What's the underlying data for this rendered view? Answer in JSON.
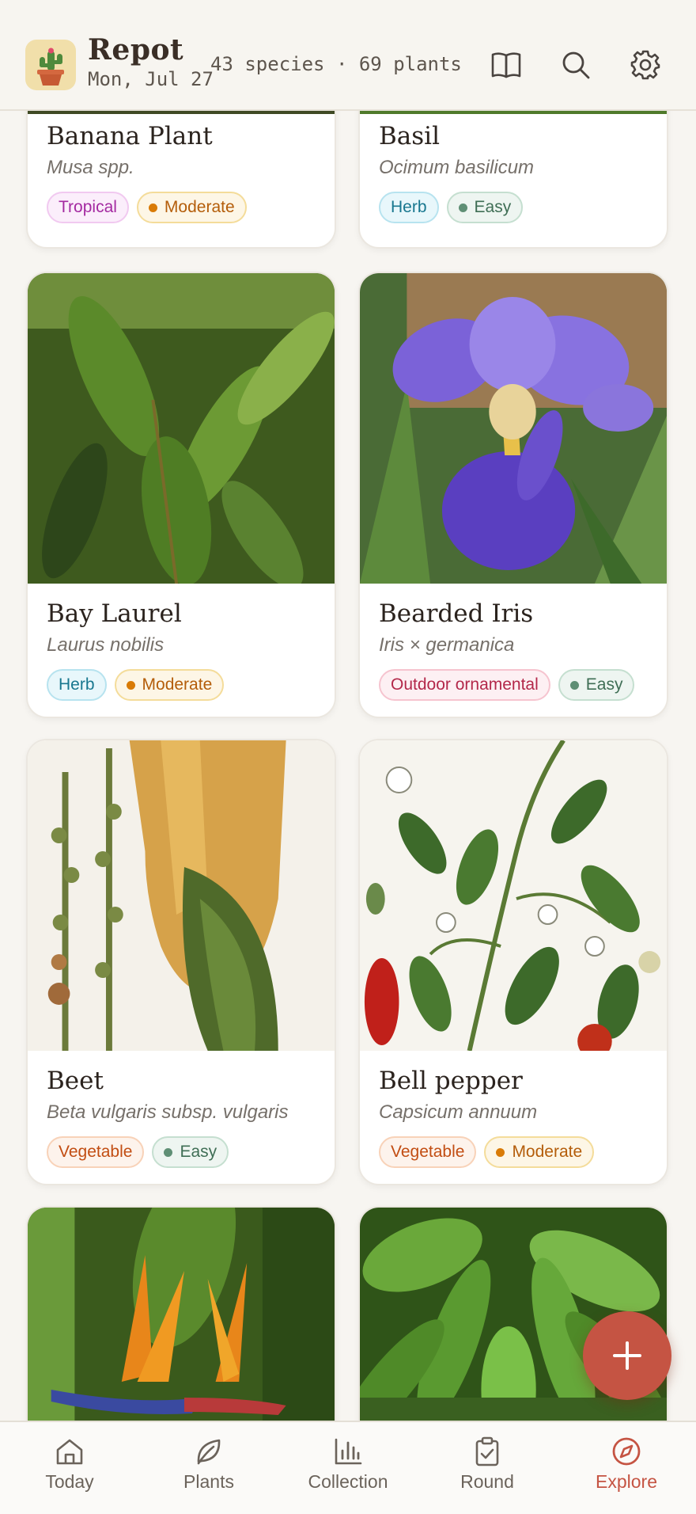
{
  "app": {
    "title": "Repot",
    "date": "Mon, Jul 27",
    "stats": "43 species · 69 plants"
  },
  "header_icons": [
    "book-icon",
    "search-icon",
    "gear-icon"
  ],
  "plants": [
    {
      "name": "Banana Plant",
      "scientific": "Musa spp.",
      "tags": [
        {
          "label": "Tropical",
          "kind": "tropical"
        },
        {
          "label": "Moderate",
          "kind": "moderate"
        }
      ]
    },
    {
      "name": "Basil",
      "scientific": "Ocimum basilicum",
      "tags": [
        {
          "label": "Herb",
          "kind": "herb"
        },
        {
          "label": "Easy",
          "kind": "easy"
        }
      ]
    },
    {
      "name": "Bay Laurel",
      "scientific": "Laurus nobilis",
      "tags": [
        {
          "label": "Herb",
          "kind": "herb"
        },
        {
          "label": "Moderate",
          "kind": "moderate"
        }
      ]
    },
    {
      "name": "Bearded Iris",
      "scientific": "Iris × germanica",
      "tags": [
        {
          "label": "Outdoor ornamental",
          "kind": "outdoor"
        },
        {
          "label": "Easy",
          "kind": "easy"
        }
      ]
    },
    {
      "name": "Beet",
      "scientific": "Beta vulgaris subsp. vulgaris",
      "tags": [
        {
          "label": "Vegetable",
          "kind": "vegetable"
        },
        {
          "label": "Easy",
          "kind": "easy"
        }
      ]
    },
    {
      "name": "Bell pepper",
      "scientific": "Capsicum annuum",
      "tags": [
        {
          "label": "Vegetable",
          "kind": "vegetable"
        },
        {
          "label": "Moderate",
          "kind": "moderate"
        }
      ]
    }
  ],
  "fab": {
    "icon": "plus-icon"
  },
  "nav": {
    "items": [
      {
        "label": "Today",
        "icon": "home-icon"
      },
      {
        "label": "Plants",
        "icon": "leaf-icon"
      },
      {
        "label": "Collection",
        "icon": "bar-chart-icon"
      },
      {
        "label": "Round",
        "icon": "clipboard-check-icon"
      },
      {
        "label": "Explore",
        "icon": "compass-icon"
      }
    ],
    "active": "Explore"
  },
  "colors": {
    "accent": "#c55443",
    "background": "#f7f5f1",
    "card": "#ffffff"
  }
}
